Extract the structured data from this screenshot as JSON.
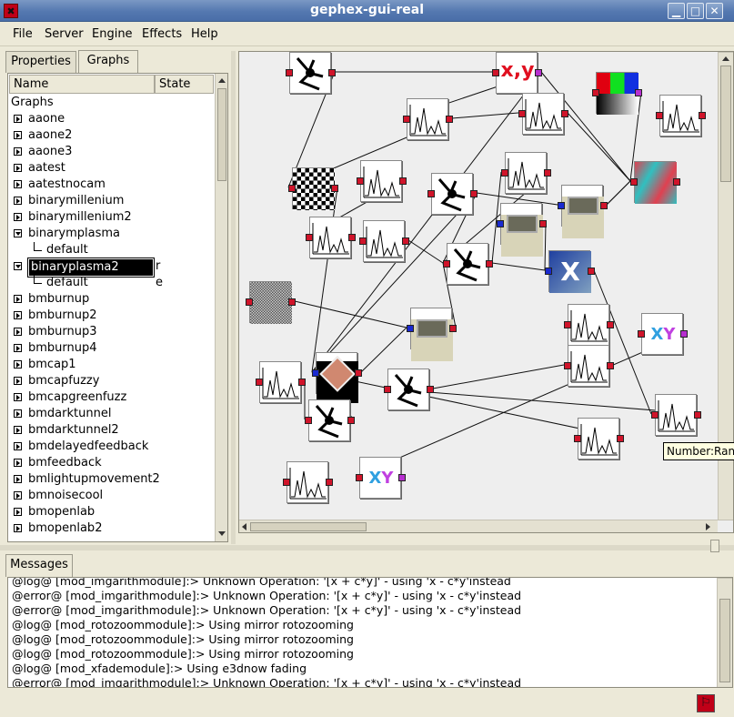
{
  "window": {
    "title": "gephex-gui-real",
    "app_icon": "gephex-logo-icon",
    "buttons": [
      "minimize-icon",
      "maximize-icon",
      "close-icon"
    ]
  },
  "menu": [
    "File",
    "Server",
    "Engine",
    "Effects",
    "Help"
  ],
  "left_tabs": [
    {
      "label": "Properties",
      "active": false
    },
    {
      "label": "Graphs",
      "active": true
    }
  ],
  "tree": {
    "headers": {
      "name": "Name",
      "state": "State"
    },
    "root": "Graphs",
    "rows": [
      {
        "label": "aaone",
        "expanded": false
      },
      {
        "label": "aaone2",
        "expanded": false
      },
      {
        "label": "aaone3",
        "expanded": false
      },
      {
        "label": "aatest",
        "expanded": false
      },
      {
        "label": "aatestnocam",
        "expanded": false
      },
      {
        "label": "binarymillenium",
        "expanded": false
      },
      {
        "label": "binarymillenium2",
        "expanded": false
      },
      {
        "label": "binarymplasma",
        "expanded": true
      },
      {
        "label": "default",
        "child": true,
        "state": ""
      },
      {
        "label": "binaryplasma2",
        "expanded": true,
        "editing": true,
        "state": "r"
      },
      {
        "label": "default",
        "child": true,
        "state": "e"
      },
      {
        "label": "bmburnup",
        "expanded": false
      },
      {
        "label": "bmburnup2",
        "expanded": false
      },
      {
        "label": "bmburnup3",
        "expanded": false
      },
      {
        "label": "bmburnup4",
        "expanded": false
      },
      {
        "label": "bmcap1",
        "expanded": false
      },
      {
        "label": "bmcapfuzzy",
        "expanded": false
      },
      {
        "label": "bmcapgreenfuzz",
        "expanded": false
      },
      {
        "label": "bmdarktunnel",
        "expanded": false
      },
      {
        "label": "bmdarktunnel2",
        "expanded": false
      },
      {
        "label": "bmdelayedfeedback",
        "expanded": false
      },
      {
        "label": "bmfeedback",
        "expanded": false
      },
      {
        "label": "bmlightupmovement2",
        "expanded": false
      },
      {
        "label": "bmnoisecool",
        "expanded": false
      },
      {
        "label": "bmopenlab",
        "expanded": false
      },
      {
        "label": "bmopenlab2",
        "expanded": false
      }
    ]
  },
  "graph": {
    "tooltip": "Number:Ran",
    "nodes": [
      {
        "kind": "mixer"
      },
      {
        "kind": "xy"
      },
      {
        "kind": "wave"
      },
      {
        "kind": "colorbar"
      },
      {
        "kind": "wave"
      },
      {
        "kind": "wave"
      },
      {
        "kind": "noise-bw"
      },
      {
        "kind": "wave"
      },
      {
        "kind": "mixer"
      },
      {
        "kind": "wave"
      },
      {
        "kind": "displace"
      },
      {
        "kind": "wave"
      },
      {
        "kind": "wave"
      },
      {
        "kind": "mixer"
      },
      {
        "kind": "device"
      },
      {
        "kind": "device"
      },
      {
        "kind": "x-image"
      },
      {
        "kind": "wave"
      },
      {
        "kind": "noise-gray"
      },
      {
        "kind": "device"
      },
      {
        "kind": "wave"
      },
      {
        "kind": "xy-small"
      },
      {
        "kind": "wave"
      },
      {
        "kind": "wave"
      },
      {
        "kind": "mixer"
      },
      {
        "kind": "photo"
      },
      {
        "kind": "wave"
      },
      {
        "kind": "mixer"
      },
      {
        "kind": "wave"
      },
      {
        "kind": "wave"
      },
      {
        "kind": "xy-small"
      }
    ]
  },
  "messages_tab": "Messages",
  "messages": [
    "@log@ [mod_imgarithmodule]:> Unknown Operation: '[x + c*y]' - using 'x - c*y'instead",
    "@error@ [mod_imgarithmodule]:> Unknown Operation: '[x + c*y]' - using 'x - c*y'instead",
    "@error@ [mod_imgarithmodule]:> Unknown Operation: '[x + c*y]' - using 'x - c*y'instead",
    "@log@ [mod_rotozoommodule]:> Using mirror rotozooming",
    "@log@ [mod_rotozoommodule]:> Using mirror rotozooming",
    "@log@ [mod_rotozoommodule]:> Using mirror rotozooming",
    "@log@ [mod_xfademodule]:> Using e3dnow fading",
    "@error@ [mod_imgarithmodule]:> Unknown Operation: '[x + c*y]' - using 'x - c*y'instead"
  ],
  "status": {
    "icon": "gephex-status-icon"
  }
}
